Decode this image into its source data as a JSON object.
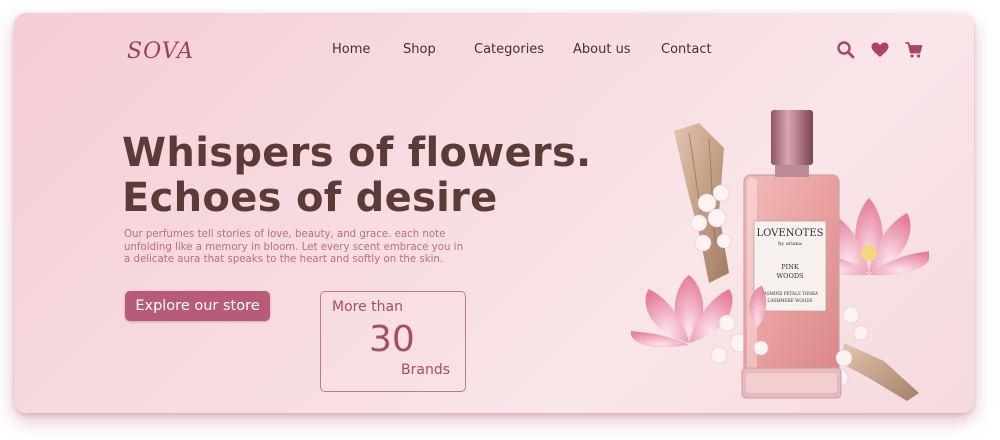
{
  "brand": {
    "logo": "SOVA"
  },
  "nav": {
    "items": [
      "Home",
      "Shop",
      "Categories",
      "About us",
      "Contact"
    ]
  },
  "icons": {
    "search": "search-icon",
    "favorites": "heart-icon",
    "cart": "cart-icon"
  },
  "hero": {
    "headline_line1": "Whispers of flowers.",
    "headline_line2": "Echoes of desire",
    "description_line1": "Our perfumes tell stories of love, beauty, and grace. each note",
    "description_line2": "unfolding like a memory in bloom. Let every scent embrace you in",
    "description_line3": "a delicate aura that speaks to the heart and softly on the skin.",
    "cta_label": "Explore our store"
  },
  "stats": {
    "prefix": "More than",
    "value": "30",
    "suffix": "Brands"
  },
  "product_label": {
    "name": "LOVENOTES",
    "by": "by ariana",
    "scent_line1": "PINK",
    "scent_line2": "WOODS",
    "notes_line1": "JASMINE PETALS TONKA",
    "notes_line2": "CASHMERE WOODS"
  },
  "colors": {
    "accent": "#b85b78",
    "heading": "#5b3a38",
    "body_text": "#b86d86",
    "logo": "#9b3f5c",
    "background": "#f6d9df"
  }
}
